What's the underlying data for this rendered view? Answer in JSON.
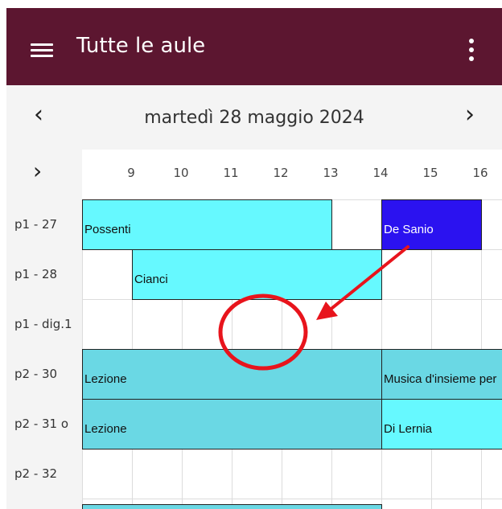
{
  "app": {
    "title": "Tutte le aule",
    "menu_icon": "hamburger-menu-icon",
    "more_icon": "more-vert-icon",
    "bar_color": "#5c1630"
  },
  "date_nav": {
    "prev": "‹",
    "next": "›",
    "date": "martedì 28 maggio 2024"
  },
  "grid": {
    "expand": "›",
    "hours": [
      "9",
      "10",
      "11",
      "12",
      "13",
      "14",
      "15",
      "16"
    ],
    "rows": [
      "p1 - 27",
      "p1 - 28",
      "p1 - dig.1",
      "p2 - 30",
      "p2 - 31 o",
      "p2 - 32"
    ],
    "events": [
      {
        "label": "Possenti",
        "color": "#66f9ff"
      },
      {
        "label": "De Sanio",
        "color": "#2b12f0"
      },
      {
        "label": "Cianci",
        "color": "#66f9ff"
      },
      {
        "label": "Lezione",
        "color": "#6ad8e4"
      },
      {
        "label": "Musica d'insieme per",
        "color": "#6ad8e4"
      },
      {
        "label": "Lezione",
        "color": "#6ad8e4"
      },
      {
        "label": "Di Lernia",
        "color": "#66f9ff"
      },
      {
        "label": "",
        "color": "#6ad8e4"
      }
    ]
  },
  "annotation": {
    "color": "#e8141c"
  }
}
